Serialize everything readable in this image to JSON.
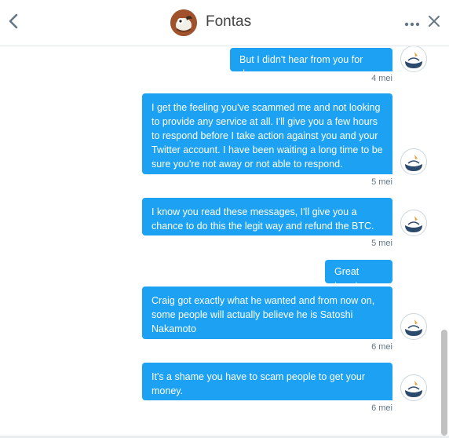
{
  "header": {
    "title": "Fontas"
  },
  "messages": [
    {
      "text": "But I didn't hear from you for days",
      "time": "4 mei"
    },
    {
      "text": "I get the feeling you've scammed me and not looking to provide any service at all. I'll give you a few hours to respond before I take action against you and your Twitter account. I have been waiting a long time to be sure you're not away or not able to respond.",
      "time": "5 mei"
    },
    {
      "text": "I know you read these messages, I'll give you a chance to do this the legit way and refund the BTC.",
      "time": "5 mei"
    },
    {
      "text": "Great tweet",
      "time": ""
    },
    {
      "text": "Craig got exactly what he wanted and from now on, some people will actually believe he is Satoshi Nakamoto",
      "time": "6 mei"
    },
    {
      "text": "It's a shame you have to scam people to get your money.",
      "time": "6 mei"
    }
  ],
  "colors": {
    "bubble": "#1da1f2",
    "timestamp": "#657786",
    "divider": "#e1e8ed"
  },
  "icons": {
    "back": "chevron-left-icon",
    "more": "more-horizontal-icon",
    "close": "close-icon"
  }
}
